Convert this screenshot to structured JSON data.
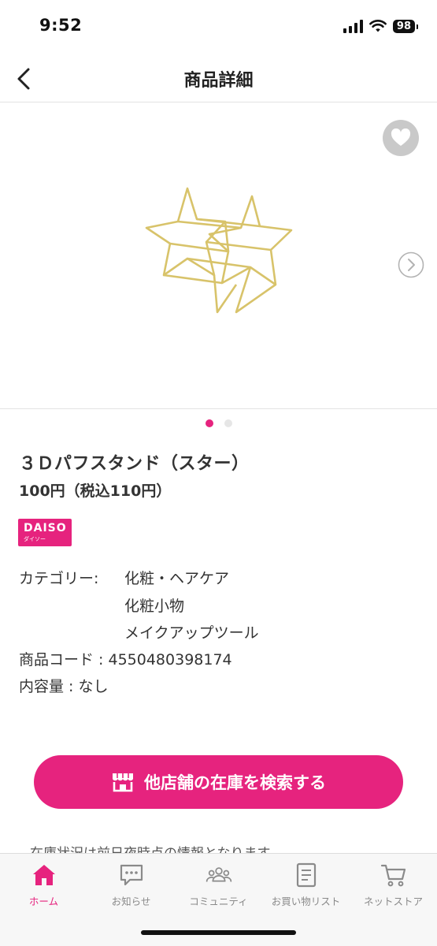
{
  "status_bar": {
    "time": "9:52",
    "battery": "98"
  },
  "header": {
    "title": "商品詳細"
  },
  "carousel": {
    "slide_count": 2,
    "active_index": 0
  },
  "product": {
    "name": "３Ｄパフスタンド（スター）",
    "price": "100円（税込110円）",
    "brand": {
      "logo_text": "DAISO",
      "logo_sub": "ダイソー"
    },
    "category_label": "カテゴリー:",
    "categories": [
      "化粧・ヘアケア",
      "化粧小物",
      "メイクアップツール"
    ],
    "code_label": "商品コード : ",
    "code_value": "4550480398174",
    "content_label": "内容量 : ",
    "content_value": "なし"
  },
  "actions": {
    "stock_search_label": "他店舗の在庫を検索する"
  },
  "stock_note": "在庫状況は前日夜時点の情報となります。",
  "tab_bar": {
    "tabs": [
      {
        "label": "ホーム",
        "icon": "home-icon",
        "active": true
      },
      {
        "label": "お知らせ",
        "icon": "chat-icon",
        "active": false
      },
      {
        "label": "コミュニティ",
        "icon": "community-icon",
        "active": false
      },
      {
        "label": "お買い物リスト",
        "icon": "list-icon",
        "active": false
      },
      {
        "label": "ネットストア",
        "icon": "cart-icon",
        "active": false
      }
    ]
  },
  "colors": {
    "accent": "#e6237e",
    "text": "#333333",
    "icon_gray": "#8a8a8a"
  }
}
